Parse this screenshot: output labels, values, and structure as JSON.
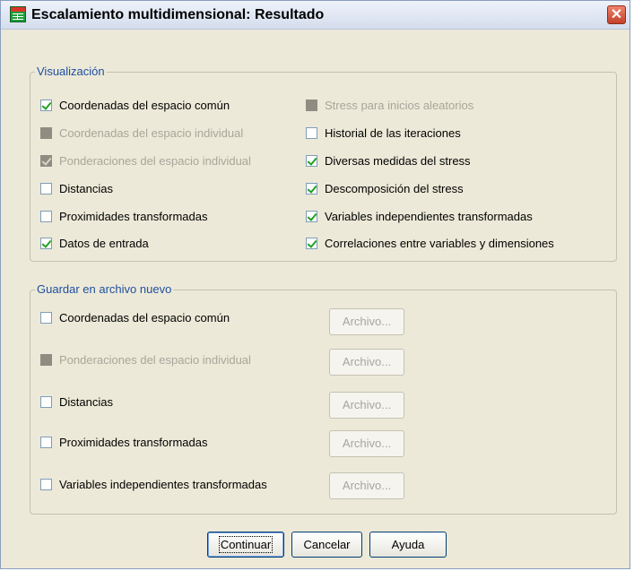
{
  "window": {
    "title": "Escalamiento multidimensional: Resultado",
    "close_glyph": "✕"
  },
  "display_group": {
    "legend": "Visualización",
    "left": [
      {
        "label": "Coordenadas del espacio común",
        "checked": true,
        "enabled": true
      },
      {
        "label": "Coordenadas del espacio individual",
        "checked": false,
        "enabled": false
      },
      {
        "label": "Ponderaciones del espacio individual",
        "checked": true,
        "enabled": false
      },
      {
        "label": "Distancias",
        "checked": false,
        "enabled": true
      },
      {
        "label": "Proximidades transformadas",
        "checked": false,
        "enabled": true
      },
      {
        "label": "Datos de entrada",
        "checked": true,
        "enabled": true
      }
    ],
    "right": [
      {
        "label": "Stress para inicios aleatorios",
        "checked": false,
        "enabled": false
      },
      {
        "label": "Historial de las iteraciones",
        "checked": false,
        "enabled": true
      },
      {
        "label": "Diversas medidas del stress",
        "checked": true,
        "enabled": true
      },
      {
        "label": "Descomposición del stress",
        "checked": true,
        "enabled": true
      },
      {
        "label": "Variables independientes transformadas",
        "checked": true,
        "enabled": true
      },
      {
        "label": "Correlaciones entre variables y dimensiones",
        "checked": true,
        "enabled": true
      }
    ]
  },
  "save_group": {
    "legend": "Guardar en archivo nuevo",
    "items": [
      {
        "label": "Coordenadas del espacio común",
        "checked": false,
        "enabled": true,
        "button": "Archivo..."
      },
      {
        "label": "Ponderaciones del espacio individual",
        "checked": false,
        "enabled": false,
        "button": "Archivo..."
      },
      {
        "label": "Distancias",
        "checked": false,
        "enabled": true,
        "button": "Archivo..."
      },
      {
        "label": "Proximidades transformadas",
        "checked": false,
        "enabled": true,
        "button": "Archivo..."
      },
      {
        "label": "Variables independientes transformadas",
        "checked": false,
        "enabled": true,
        "button": "Archivo..."
      }
    ]
  },
  "buttons": {
    "continue": "Continuar",
    "cancel": "Cancelar",
    "help": "Ayuda"
  }
}
